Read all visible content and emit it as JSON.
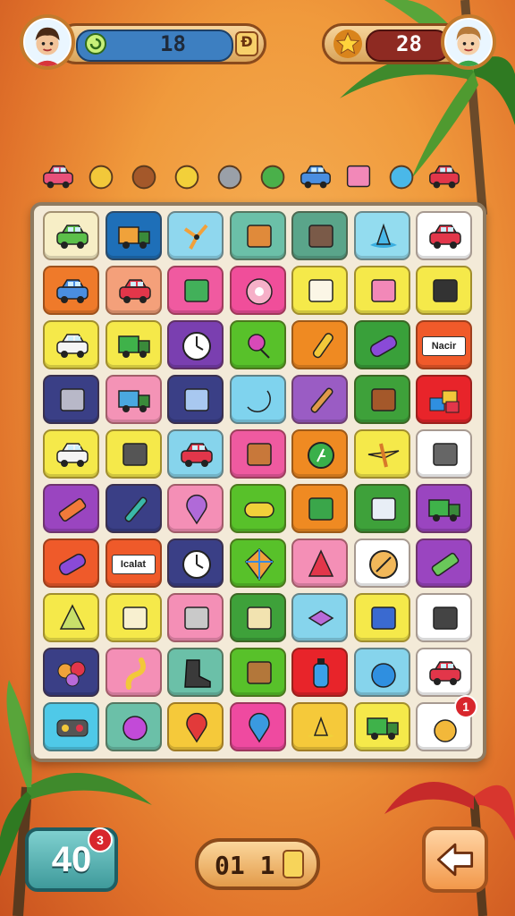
{
  "player_left": {
    "avatar": "boy-avatar",
    "score": "18",
    "left_icon": "refresh-icon",
    "right_icon": "coin-icon"
  },
  "player_right": {
    "avatar": "boy-avatar-2",
    "score": "28",
    "icon": "star-icon"
  },
  "collection": [
    "pink-car",
    "yellow-gear",
    "brown-gear",
    "yellow-ring",
    "grey-camera",
    "green-plane",
    "blue-car",
    "pink-box",
    "blue-bird",
    "red-car"
  ],
  "grid": {
    "rows": 10,
    "cols": 7,
    "tiles": [
      [
        {
          "bg": "#f7eec6",
          "icon": "green-car"
        },
        {
          "bg": "#1e6fb8",
          "icon": "orange-van"
        },
        {
          "bg": "#8fd7ee",
          "icon": "wind-spinner"
        },
        {
          "bg": "#6bc0a8",
          "icon": "orange-tray"
        },
        {
          "bg": "#5aa58a",
          "icon": "striped-panel"
        },
        {
          "bg": "#93dcef",
          "icon": "blue-hat"
        },
        {
          "bg": "#ffffff",
          "icon": "red-car"
        }
      ],
      [
        {
          "bg": "#ef7a2a",
          "icon": "blue-car"
        },
        {
          "bg": "#f4a07a",
          "icon": "red-car"
        },
        {
          "bg": "#f05aa0",
          "icon": "green-camera"
        },
        {
          "bg": "#f04e9a",
          "icon": "pink-tape"
        },
        {
          "bg": "#f5e94a",
          "icon": "white-paper"
        },
        {
          "bg": "#f5e94a",
          "icon": "pink-box"
        },
        {
          "bg": "#f5e94a",
          "icon": "dark-radio"
        }
      ],
      [
        {
          "bg": "#f5e94a",
          "icon": "white-car"
        },
        {
          "bg": "#f5e94a",
          "icon": "green-truck"
        },
        {
          "bg": "#7a3fb0",
          "icon": "clock-dial"
        },
        {
          "bg": "#58c12a",
          "icon": "pink-pin"
        },
        {
          "bg": "#ef8a22",
          "icon": "microphone"
        },
        {
          "bg": "#39a03a",
          "icon": "rainbow-tube"
        },
        {
          "bg": "#f05a2a",
          "icon": "label-tag",
          "label": "Nacir"
        }
      ],
      [
        {
          "bg": "#3a3f86",
          "icon": "grey-box"
        },
        {
          "bg": "#f493b6",
          "icon": "blue-truck"
        },
        {
          "bg": "#3a3f86",
          "icon": "blue-box"
        },
        {
          "bg": "#7fd3ee",
          "icon": "yellow-moon"
        },
        {
          "bg": "#9a5cc4",
          "icon": "brush"
        },
        {
          "bg": "#3ea13a",
          "icon": "brown-frame"
        },
        {
          "bg": "#e8242a",
          "icon": "toy-blocks"
        }
      ],
      [
        {
          "bg": "#f5e94a",
          "icon": "white-car"
        },
        {
          "bg": "#f5e94a",
          "icon": "speaker"
        },
        {
          "bg": "#86d4ec",
          "icon": "red-car"
        },
        {
          "bg": "#ef5aa0",
          "icon": "basket"
        },
        {
          "bg": "#ef8a22",
          "icon": "green-coin"
        },
        {
          "bg": "#f5e94a",
          "icon": "toy-plane"
        },
        {
          "bg": "#ffffff",
          "icon": "dice"
        }
      ],
      [
        {
          "bg": "#9a45c0",
          "icon": "orange-bar"
        },
        {
          "bg": "#3a3f86",
          "icon": "pen"
        },
        {
          "bg": "#f48fb6",
          "icon": "purple-pin"
        },
        {
          "bg": "#58c12a",
          "icon": "yellow-roll"
        },
        {
          "bg": "#ef8a22",
          "icon": "green-box"
        },
        {
          "bg": "#3ea13a",
          "icon": "white-machine"
        },
        {
          "bg": "#9a45c0",
          "icon": "green-truck"
        }
      ],
      [
        {
          "bg": "#ef5a2a",
          "icon": "rainbow-tube"
        },
        {
          "bg": "#ef5a2a",
          "icon": "label-tag",
          "label": "Icalat"
        },
        {
          "bg": "#3a3f86",
          "icon": "clock-dial"
        },
        {
          "bg": "#58c12a",
          "icon": "kite"
        },
        {
          "bg": "#f48fb6",
          "icon": "pyramid-toy"
        },
        {
          "bg": "#ffffff",
          "icon": "compass"
        },
        {
          "bg": "#9a45c0",
          "icon": "stick-candy"
        }
      ],
      [
        {
          "bg": "#f5e94a",
          "icon": "melon-slice"
        },
        {
          "bg": "#f5e94a",
          "icon": "striped-box"
        },
        {
          "bg": "#f48fb6",
          "icon": "grey-cube"
        },
        {
          "bg": "#3ea13a",
          "icon": "note-pad"
        },
        {
          "bg": "#86d4ec",
          "icon": "wind-bird"
        },
        {
          "bg": "#f5e94a",
          "icon": "blue-book"
        },
        {
          "bg": "#ffffff",
          "icon": "black-radio"
        }
      ],
      [
        {
          "bg": "#3a3f86",
          "icon": "balloons"
        },
        {
          "bg": "#f48fb6",
          "icon": "yellow-hook"
        },
        {
          "bg": "#6bc0a8",
          "icon": "dark-boot"
        },
        {
          "bg": "#58c12a",
          "icon": "briefcase"
        },
        {
          "bg": "#e8242a",
          "icon": "blue-bottle"
        },
        {
          "bg": "#86d4ec",
          "icon": "blue-ball"
        },
        {
          "bg": "#ffffff",
          "icon": "red-car"
        }
      ],
      [
        {
          "bg": "#4fc9e8",
          "icon": "traffic-light"
        },
        {
          "bg": "#6bc0a8",
          "icon": "purple-ball"
        },
        {
          "bg": "#f5c93a",
          "icon": "red-pin"
        },
        {
          "bg": "#ef4aa0",
          "icon": "blue-pin"
        },
        {
          "bg": "#f5c93a",
          "icon": "yellow-hat"
        },
        {
          "bg": "#f5e94a",
          "icon": "green-truck"
        },
        {
          "bg": "#ffffff",
          "icon": "yellow-fruit",
          "badge": "1"
        }
      ]
    ]
  },
  "bottom": {
    "score_value": "40",
    "score_badge": "3",
    "counter_value": "01 1",
    "counter_icon": "coin-icon",
    "back_icon": "arrow-left-icon"
  },
  "colors": {
    "hud_blue": "#3d7fc1",
    "hud_red": "#8e2a22",
    "badge_red": "#d8262c"
  }
}
